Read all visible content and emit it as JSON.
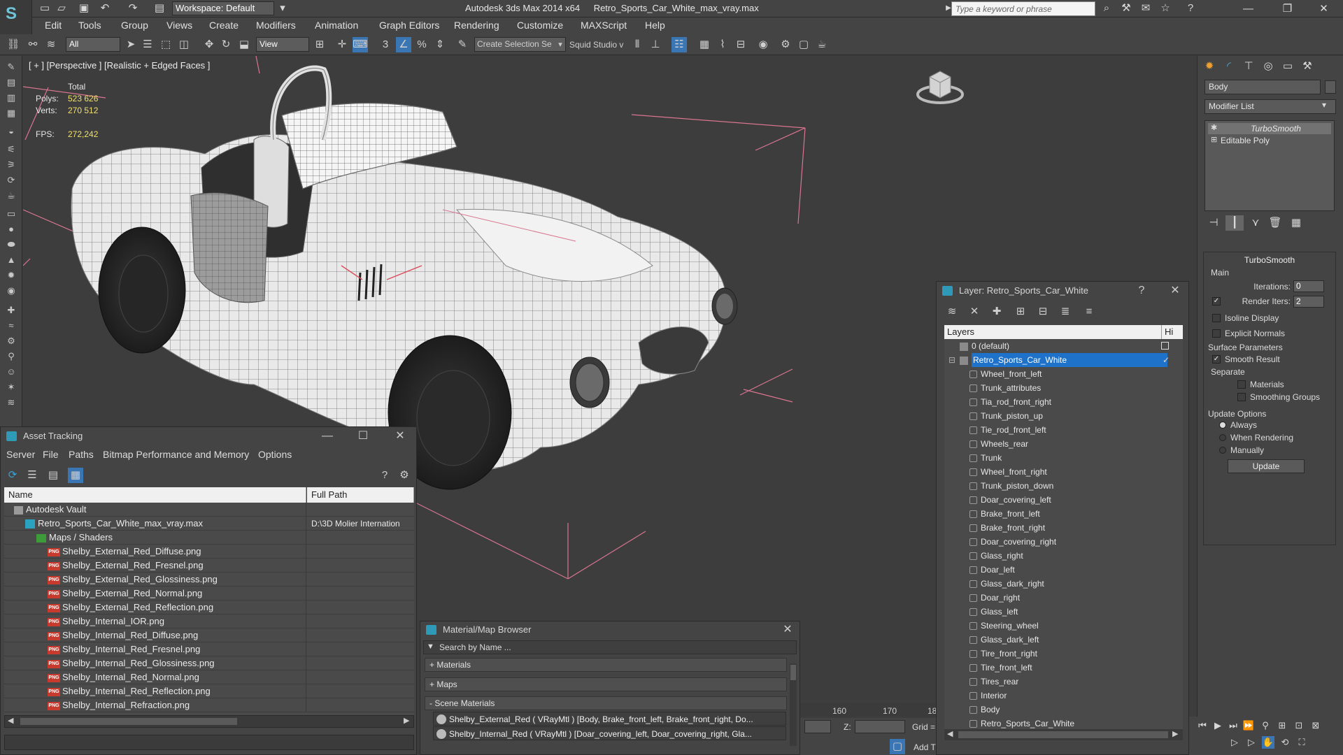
{
  "window": {
    "app_name": "Autodesk 3ds Max  2014 x64",
    "file_name": "Retro_Sports_Car_White_max_vray.max",
    "workspace": "Workspace: Default",
    "search_placeholder": "Type a keyword or phrase"
  },
  "menu": [
    "Edit",
    "Tools",
    "Group",
    "Views",
    "Create",
    "Modifiers",
    "Animation",
    "Graph Editors",
    "Rendering",
    "Customize",
    "MAXScript",
    "Help"
  ],
  "toolbar": {
    "filter": "All",
    "ref_coord": "View",
    "selection_set": "Create Selection Se",
    "squid": "Squid Studio v"
  },
  "viewport": {
    "label": "[ + ] [Perspective ] [Realistic + Edged Faces ]",
    "stats": {
      "total_label": "Total",
      "polys_label": "Polys:",
      "polys": "523 626",
      "verts_label": "Verts:",
      "verts": "270 512",
      "fps_label": "FPS:",
      "fps": "272,242"
    }
  },
  "command_panel": {
    "object_name": "Body",
    "modifier_list": "Modifier List",
    "stack": [
      "TurboSmooth",
      "Editable Poly"
    ],
    "turbosmooth": {
      "title": "TurboSmooth",
      "main": "Main",
      "iterations_label": "Iterations:",
      "iterations": "0",
      "render_iters_label": "Render Iters:",
      "render_iters": "2",
      "isoline": "Isoline Display",
      "explicit_normals": "Explicit Normals",
      "surface_params": "Surface Parameters",
      "smooth_result": "Smooth Result",
      "separate": "Separate",
      "materials": "Materials",
      "smoothing_groups": "Smoothing Groups",
      "update_options": "Update Options",
      "always": "Always",
      "when_rendering": "When Rendering",
      "manually": "Manually",
      "update_button": "Update"
    }
  },
  "asset_tracking": {
    "title": "Asset Tracking",
    "menu": [
      "Server",
      "File",
      "Paths",
      "Bitmap Performance and Memory",
      "Options"
    ],
    "col_name": "Name",
    "col_path": "Full Path",
    "rows": [
      {
        "name": "Autodesk Vault",
        "path": "",
        "type": "vault",
        "indent": 1
      },
      {
        "name": "Retro_Sports_Car_White_max_vray.max",
        "path": "D:\\3D Molier Internation",
        "type": "max",
        "indent": 2
      },
      {
        "name": "Maps / Shaders",
        "path": "",
        "type": "folder",
        "indent": 3
      },
      {
        "name": "Shelby_External_Red_Diffuse.png",
        "path": "",
        "type": "png",
        "indent": 4
      },
      {
        "name": "Shelby_External_Red_Fresnel.png",
        "path": "",
        "type": "png",
        "indent": 4
      },
      {
        "name": "Shelby_External_Red_Glossiness.png",
        "path": "",
        "type": "png",
        "indent": 4
      },
      {
        "name": "Shelby_External_Red_Normal.png",
        "path": "",
        "type": "png",
        "indent": 4
      },
      {
        "name": "Shelby_External_Red_Reflection.png",
        "path": "",
        "type": "png",
        "indent": 4
      },
      {
        "name": "Shelby_Internal_IOR.png",
        "path": "",
        "type": "png",
        "indent": 4
      },
      {
        "name": "Shelby_Internal_Red_Diffuse.png",
        "path": "",
        "type": "png",
        "indent": 4
      },
      {
        "name": "Shelby_Internal_Red_Fresnel.png",
        "path": "",
        "type": "png",
        "indent": 4
      },
      {
        "name": "Shelby_Internal_Red_Glossiness.png",
        "path": "",
        "type": "png",
        "indent": 4
      },
      {
        "name": "Shelby_Internal_Red_Normal.png",
        "path": "",
        "type": "png",
        "indent": 4
      },
      {
        "name": "Shelby_Internal_Red_Reflection.png",
        "path": "",
        "type": "png",
        "indent": 4
      },
      {
        "name": "Shelby_Internal_Refraction.png",
        "path": "",
        "type": "png",
        "indent": 4
      }
    ]
  },
  "material_browser": {
    "title": "Material/Map Browser",
    "search_placeholder": "Search by Name ...",
    "sections": [
      "+ Materials",
      "+ Maps",
      "- Scene Materials"
    ],
    "materials": [
      "Shelby_External_Red  ( VRayMtl ) [Body, Brake_front_left, Brake_front_right, Do...",
      "Shelby_Internal_Red  ( VRayMtl ) [Doar_covering_left, Doar_covering_right, Gla..."
    ]
  },
  "layer_explorer": {
    "title": "Layer: Retro_Sports_Car_White",
    "help": "?",
    "col_layers": "Layers",
    "col_hide": "Hi",
    "default_layer": "0 (default)",
    "active_layer": "Retro_Sports_Car_White",
    "objects": [
      "Wheel_front_left",
      "Trunk_attributes",
      "Tia_rod_front_right",
      "Trunk_piston_up",
      "Tie_rod_front_left",
      "Wheels_rear",
      "Trunk",
      "Wheel_front_right",
      "Trunk_piston_down",
      "Doar_covering_left",
      "Brake_front_left",
      "Brake_front_right",
      "Doar_covering_right",
      "Glass_right",
      "Doar_left",
      "Glass_dark_right",
      "Doar_right",
      "Glass_left",
      "Steering_wheel",
      "Glass_dark_left",
      "Tire_front_right",
      "Tire_front_left",
      "Tires_rear",
      "Interior",
      "Body",
      "Retro_Sports_Car_White"
    ]
  },
  "timeline": {
    "ticks": [
      "160",
      "170",
      "18"
    ],
    "z_label": "Z:",
    "grid_label": "Grid =",
    "add_label": "Add T"
  }
}
